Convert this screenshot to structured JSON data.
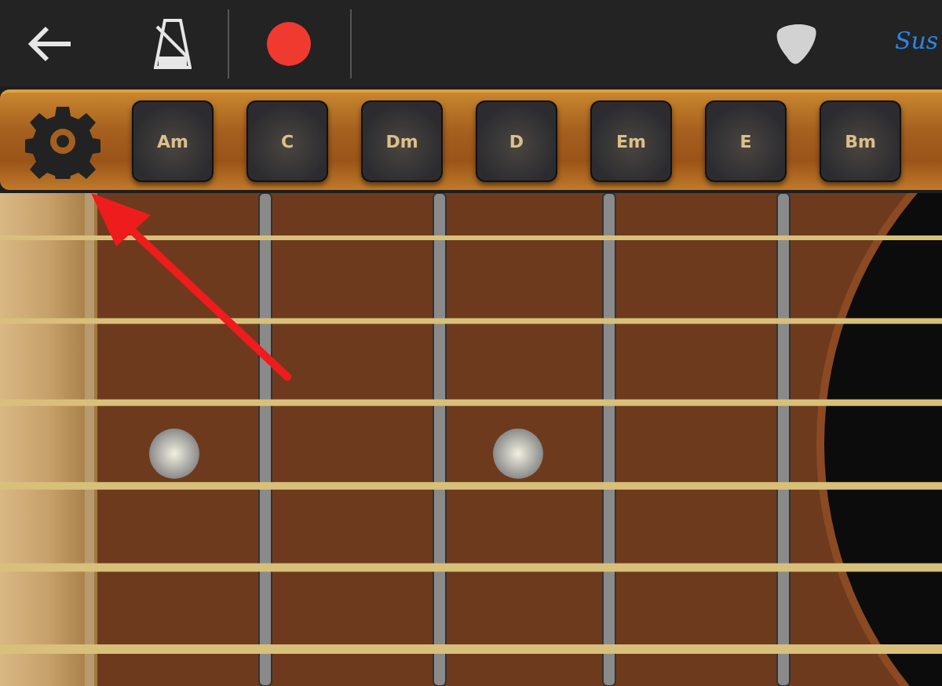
{
  "toolbar": {
    "mode_label": "Sus"
  },
  "chord_bar": {
    "chords": [
      {
        "label": "Am"
      },
      {
        "label": "C"
      },
      {
        "label": "Dm"
      },
      {
        "label": "D"
      },
      {
        "label": "Em"
      },
      {
        "label": "E"
      },
      {
        "label": "Bm"
      }
    ]
  }
}
